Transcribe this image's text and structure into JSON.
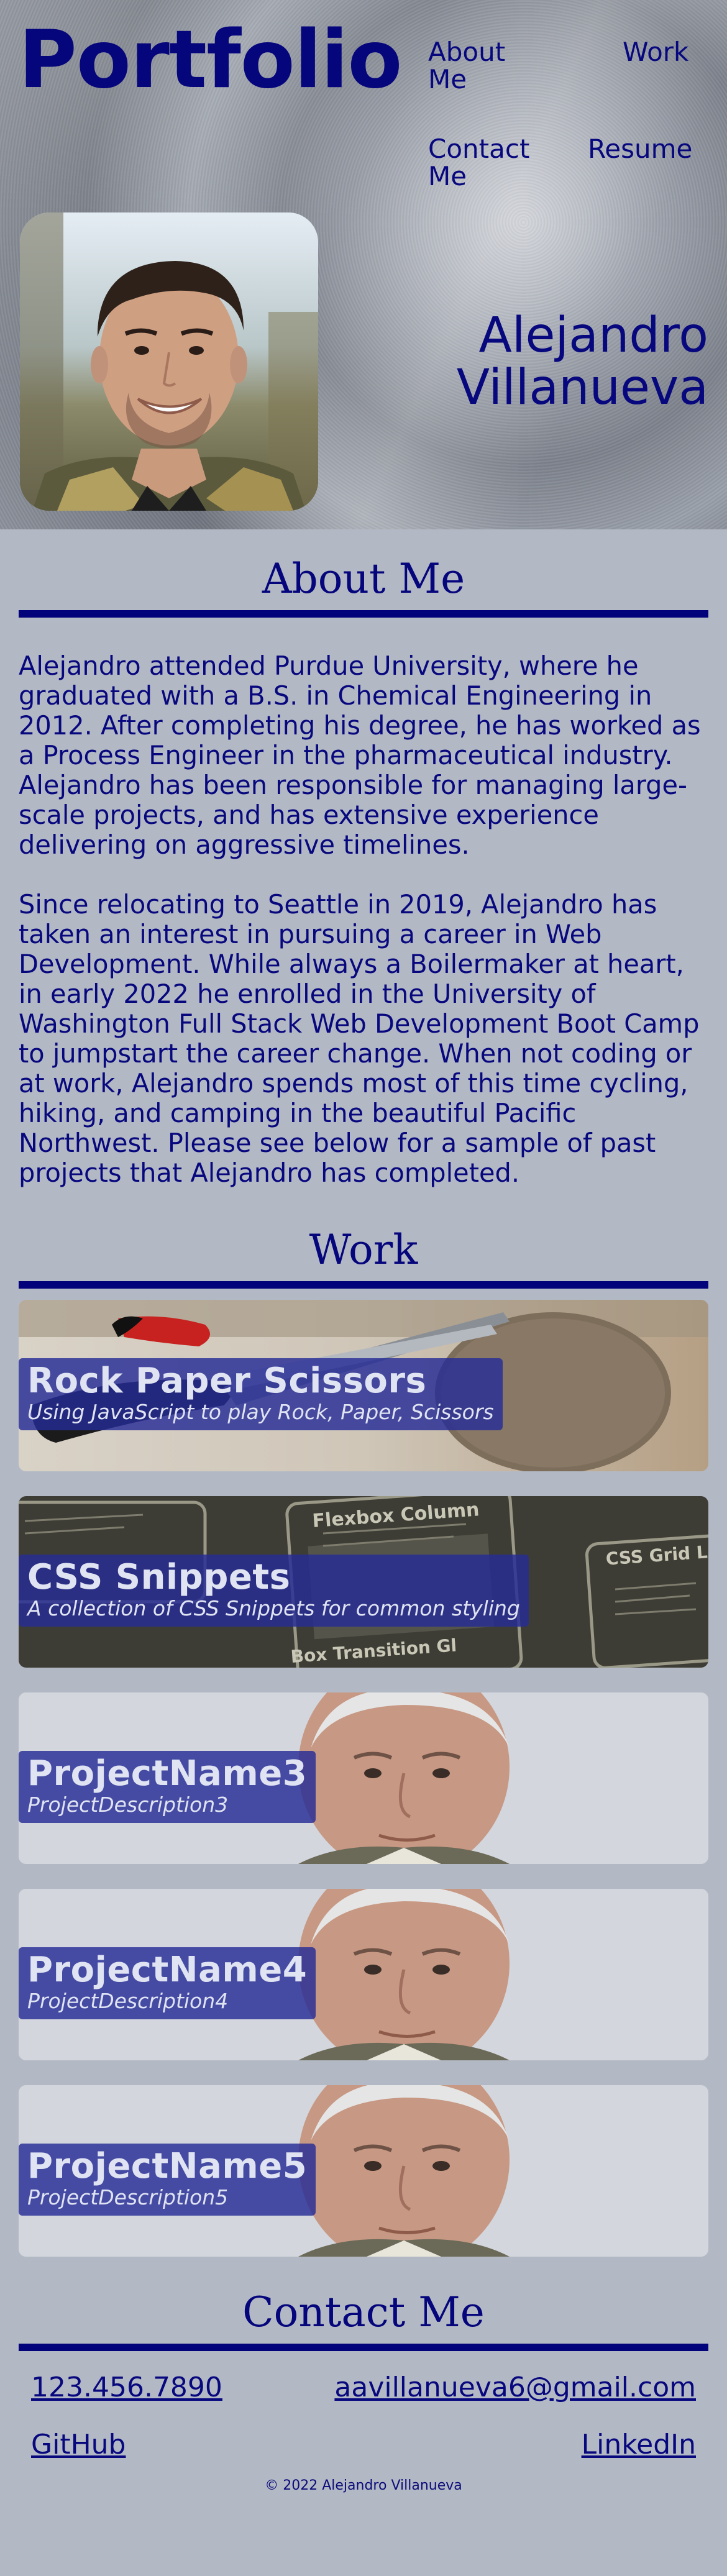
{
  "header": {
    "logo": "Portfolio",
    "nav": {
      "about": "About Me",
      "work": "Work",
      "contact": "Contact Me",
      "resume": "Resume"
    },
    "name_first": "Alejandro",
    "name_last": "Villanueva"
  },
  "about": {
    "title": "About Me",
    "paragraphs": [
      "Alejandro attended Purdue University, where he graduated with a B.S. in Chemical Engineering in 2012. After completing his degree, he has worked as a Process Engineer in the pharmaceutical industry. Alejandro has been responsible for managing large-scale projects, and has extensive experience delivering on aggressive timelines.",
      "Since relocating to Seattle in 2019, Alejandro has taken an interest in pursuing a career in Web Development. While always a Boilermaker at heart, in early 2022 he enrolled in the University of Washington Full Stack Web Development Boot Camp to jumpstart the career change. When not coding or at work, Alejandro spends most of this time cycling, hiking, and camping in the beautiful Pacific Northwest. Please see below for a sample of past projects that Alejandro has completed."
    ]
  },
  "work": {
    "title": "Work",
    "projects": [
      {
        "title": "Rock Paper Scissors",
        "description": "Using JavaScript to play Rock, Paper, Scissors"
      },
      {
        "title": "CSS Snippets",
        "description": "A collection of CSS Snippets for common styling"
      },
      {
        "title": "ProjectName3",
        "description": "ProjectDescription3"
      },
      {
        "title": "ProjectName4",
        "description": "ProjectDescription4"
      },
      {
        "title": "ProjectName5",
        "description": "ProjectDescription5"
      }
    ],
    "snippet_screens": {
      "flexbox": "Flexbox Column",
      "grid": "CSS Grid La",
      "transition": "Box Transition Gl"
    }
  },
  "contact": {
    "title": "Contact Me",
    "phone": "123.456.7890",
    "email": "aavillanueva6@gmail.com",
    "github": "GitHub",
    "linkedin": "LinkedIn"
  },
  "footer": {
    "copyright": "© 2022 Alejandro Villanueva"
  },
  "colors": {
    "accent": "#02027a",
    "background": "#b3b9c4",
    "card_label": "#262c96"
  }
}
